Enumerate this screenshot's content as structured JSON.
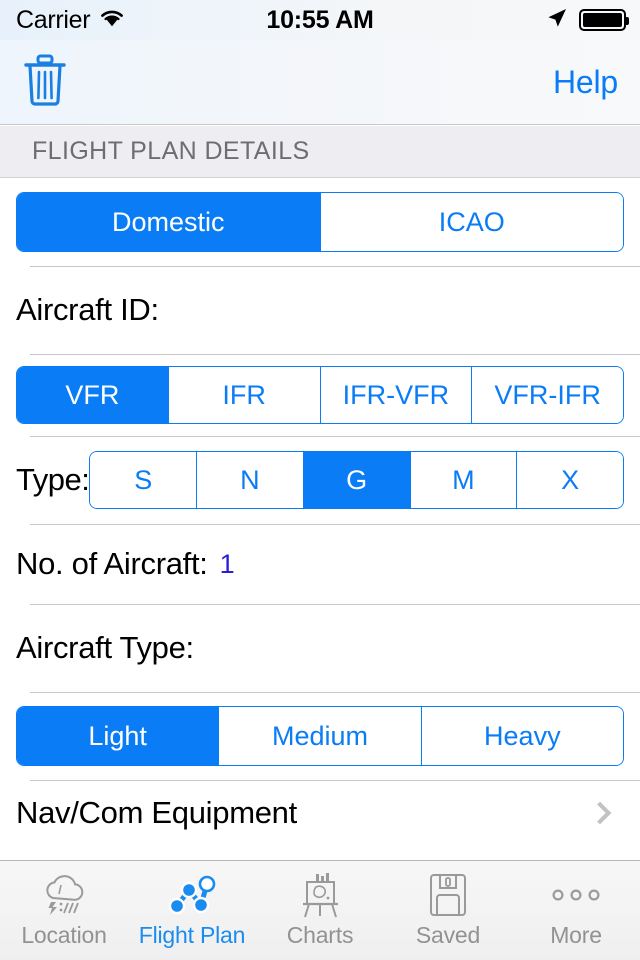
{
  "status_bar": {
    "carrier": "Carrier",
    "wifi_icon": "wifi-icon",
    "time": "10:55 AM",
    "location_icon": "location-arrow-icon",
    "battery_icon": "battery-full-icon"
  },
  "nav_bar": {
    "delete_icon": "trash-icon",
    "help_label": "Help"
  },
  "section": {
    "header": "FLIGHT PLAN DETAILS"
  },
  "form": {
    "plan_type": {
      "options": [
        "Domestic",
        "ICAO"
      ],
      "selected": "Domestic"
    },
    "aircraft_id": {
      "label": "Aircraft ID:",
      "value": ""
    },
    "flight_rules": {
      "options": [
        "VFR",
        "IFR",
        "IFR-VFR",
        "VFR-IFR"
      ],
      "selected": "VFR"
    },
    "type": {
      "label": "Type:",
      "options": [
        "S",
        "N",
        "G",
        "M",
        "X"
      ],
      "selected": "G"
    },
    "no_of_aircraft": {
      "label": "No. of Aircraft:",
      "value": "1"
    },
    "aircraft_type": {
      "label": "Aircraft Type:",
      "value": ""
    },
    "wake_turbulence": {
      "options": [
        "Light",
        "Medium",
        "Heavy"
      ],
      "selected": "Light"
    },
    "nav_com": {
      "label": "Nav/Com Equipment",
      "disclosure_icon": "chevron-right-icon"
    }
  },
  "tab_bar": {
    "tabs": [
      {
        "label": "Location",
        "icon": "cloud-rain-lightning-icon",
        "active": false
      },
      {
        "label": "Flight Plan",
        "icon": "waypoint-network-icon",
        "active": true
      },
      {
        "label": "Charts",
        "icon": "easel-map-icon",
        "active": false
      },
      {
        "label": "Saved",
        "icon": "floppy-disk-icon",
        "active": false
      },
      {
        "label": "More",
        "icon": "three-dots-icon",
        "active": false
      }
    ]
  },
  "colors": {
    "accent_blue": "#0a7cf6",
    "tab_active": "#1a8cf0",
    "value_blue": "#2a1ed6",
    "section_header_text": "#6d6d72"
  }
}
